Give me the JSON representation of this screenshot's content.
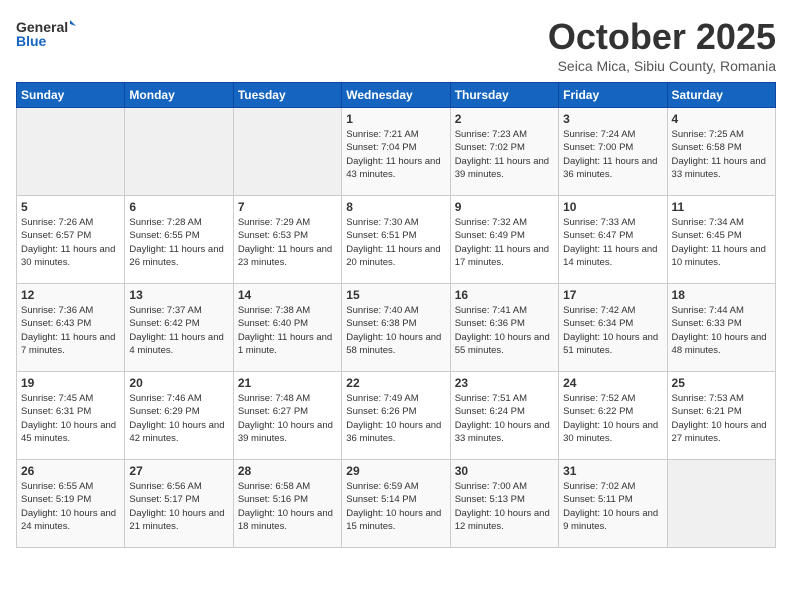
{
  "header": {
    "logo_general": "General",
    "logo_blue": "Blue",
    "title": "October 2025",
    "subtitle": "Seica Mica, Sibiu County, Romania"
  },
  "weekdays": [
    "Sunday",
    "Monday",
    "Tuesday",
    "Wednesday",
    "Thursday",
    "Friday",
    "Saturday"
  ],
  "weeks": [
    [
      {
        "day": "",
        "empty": true
      },
      {
        "day": "",
        "empty": true
      },
      {
        "day": "",
        "empty": true
      },
      {
        "day": "1",
        "sunrise": "7:21 AM",
        "sunset": "7:04 PM",
        "daylight": "11 hours and 43 minutes."
      },
      {
        "day": "2",
        "sunrise": "7:23 AM",
        "sunset": "7:02 PM",
        "daylight": "11 hours and 39 minutes."
      },
      {
        "day": "3",
        "sunrise": "7:24 AM",
        "sunset": "7:00 PM",
        "daylight": "11 hours and 36 minutes."
      },
      {
        "day": "4",
        "sunrise": "7:25 AM",
        "sunset": "6:58 PM",
        "daylight": "11 hours and 33 minutes."
      }
    ],
    [
      {
        "day": "5",
        "sunrise": "7:26 AM",
        "sunset": "6:57 PM",
        "daylight": "11 hours and 30 minutes."
      },
      {
        "day": "6",
        "sunrise": "7:28 AM",
        "sunset": "6:55 PM",
        "daylight": "11 hours and 26 minutes."
      },
      {
        "day": "7",
        "sunrise": "7:29 AM",
        "sunset": "6:53 PM",
        "daylight": "11 hours and 23 minutes."
      },
      {
        "day": "8",
        "sunrise": "7:30 AM",
        "sunset": "6:51 PM",
        "daylight": "11 hours and 20 minutes."
      },
      {
        "day": "9",
        "sunrise": "7:32 AM",
        "sunset": "6:49 PM",
        "daylight": "11 hours and 17 minutes."
      },
      {
        "day": "10",
        "sunrise": "7:33 AM",
        "sunset": "6:47 PM",
        "daylight": "11 hours and 14 minutes."
      },
      {
        "day": "11",
        "sunrise": "7:34 AM",
        "sunset": "6:45 PM",
        "daylight": "11 hours and 10 minutes."
      }
    ],
    [
      {
        "day": "12",
        "sunrise": "7:36 AM",
        "sunset": "6:43 PM",
        "daylight": "11 hours and 7 minutes."
      },
      {
        "day": "13",
        "sunrise": "7:37 AM",
        "sunset": "6:42 PM",
        "daylight": "11 hours and 4 minutes."
      },
      {
        "day": "14",
        "sunrise": "7:38 AM",
        "sunset": "6:40 PM",
        "daylight": "11 hours and 1 minute."
      },
      {
        "day": "15",
        "sunrise": "7:40 AM",
        "sunset": "6:38 PM",
        "daylight": "10 hours and 58 minutes."
      },
      {
        "day": "16",
        "sunrise": "7:41 AM",
        "sunset": "6:36 PM",
        "daylight": "10 hours and 55 minutes."
      },
      {
        "day": "17",
        "sunrise": "7:42 AM",
        "sunset": "6:34 PM",
        "daylight": "10 hours and 51 minutes."
      },
      {
        "day": "18",
        "sunrise": "7:44 AM",
        "sunset": "6:33 PM",
        "daylight": "10 hours and 48 minutes."
      }
    ],
    [
      {
        "day": "19",
        "sunrise": "7:45 AM",
        "sunset": "6:31 PM",
        "daylight": "10 hours and 45 minutes."
      },
      {
        "day": "20",
        "sunrise": "7:46 AM",
        "sunset": "6:29 PM",
        "daylight": "10 hours and 42 minutes."
      },
      {
        "day": "21",
        "sunrise": "7:48 AM",
        "sunset": "6:27 PM",
        "daylight": "10 hours and 39 minutes."
      },
      {
        "day": "22",
        "sunrise": "7:49 AM",
        "sunset": "6:26 PM",
        "daylight": "10 hours and 36 minutes."
      },
      {
        "day": "23",
        "sunrise": "7:51 AM",
        "sunset": "6:24 PM",
        "daylight": "10 hours and 33 minutes."
      },
      {
        "day": "24",
        "sunrise": "7:52 AM",
        "sunset": "6:22 PM",
        "daylight": "10 hours and 30 minutes."
      },
      {
        "day": "25",
        "sunrise": "7:53 AM",
        "sunset": "6:21 PM",
        "daylight": "10 hours and 27 minutes."
      }
    ],
    [
      {
        "day": "26",
        "sunrise": "6:55 AM",
        "sunset": "5:19 PM",
        "daylight": "10 hours and 24 minutes."
      },
      {
        "day": "27",
        "sunrise": "6:56 AM",
        "sunset": "5:17 PM",
        "daylight": "10 hours and 21 minutes."
      },
      {
        "day": "28",
        "sunrise": "6:58 AM",
        "sunset": "5:16 PM",
        "daylight": "10 hours and 18 minutes."
      },
      {
        "day": "29",
        "sunrise": "6:59 AM",
        "sunset": "5:14 PM",
        "daylight": "10 hours and 15 minutes."
      },
      {
        "day": "30",
        "sunrise": "7:00 AM",
        "sunset": "5:13 PM",
        "daylight": "10 hours and 12 minutes."
      },
      {
        "day": "31",
        "sunrise": "7:02 AM",
        "sunset": "5:11 PM",
        "daylight": "10 hours and 9 minutes."
      },
      {
        "day": "",
        "empty": true
      }
    ]
  ]
}
